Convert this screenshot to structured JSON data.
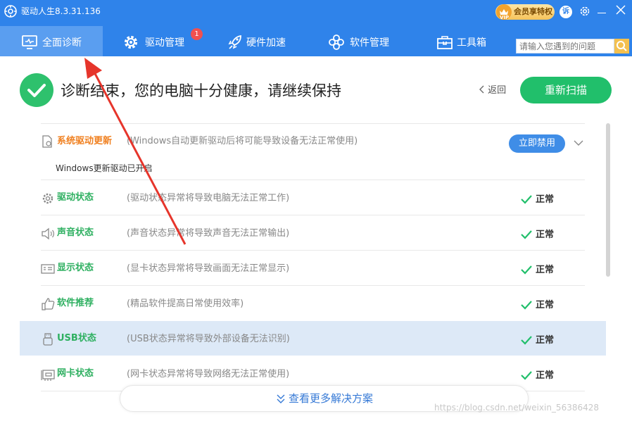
{
  "app": {
    "title": "驱动人生8.3.31.136"
  },
  "vip": {
    "label": "会员享特权",
    "mini": "VIP"
  },
  "window": {
    "sue_label": "诉"
  },
  "nav": {
    "tabs": [
      {
        "label": "全面诊断",
        "icon": "monitor-icon",
        "active": true
      },
      {
        "label": "驱动管理",
        "icon": "gear-icon"
      },
      {
        "label": "硬件加速",
        "icon": "rocket-icon"
      },
      {
        "label": "软件管理",
        "icon": "flower-icon"
      },
      {
        "label": "工具箱",
        "icon": "toolbox-icon"
      }
    ],
    "driver_badge": "1"
  },
  "search": {
    "placeholder": "请输入您遇到的问题"
  },
  "header": {
    "title": "诊断结束，您的电脑十分健康，请继续保持",
    "back": "返回",
    "rescan": "重新扫描"
  },
  "system_update": {
    "label": "系统驱动更新",
    "desc": "(Windows自动更新驱动后将可能导致设备无法正常使用)",
    "button": "立即禁用",
    "sub": "Windows更新驱动已开启"
  },
  "rows": [
    {
      "label": "驱动状态",
      "desc": "(驱动状态异常将导致电脑无法正常工作)",
      "status": "正常",
      "icon": "gear-icon"
    },
    {
      "label": "声音状态",
      "desc": "(声音状态异常将导致声音无法正常输出)",
      "status": "正常",
      "icon": "speaker-icon"
    },
    {
      "label": "显示状态",
      "desc": "(显卡状态异常将导致画面无法正常显示)",
      "status": "正常",
      "icon": "display-card-icon"
    },
    {
      "label": "软件推荐",
      "desc": "(精品软件提高日常使用效率)",
      "status": "正常",
      "icon": "thumbs-up-icon"
    },
    {
      "label": "USB状态",
      "desc": "(USB状态异常将导致外部设备无法识别)",
      "status": "正常",
      "icon": "usb-icon"
    },
    {
      "label": "网卡状态",
      "desc": "(网卡状态异常将导致网络无法正常使用)",
      "status": "正常",
      "icon": "network-card-icon"
    }
  ],
  "more": {
    "label": "查看更多解决方案"
  },
  "watermark": "https://blog.csdn.net/weixin_56386428",
  "colors": {
    "nav_bg": "#2f83ea",
    "success": "#21bf6b",
    "accent_orange": "#f08020",
    "annotation_arrow": "#e6352b"
  }
}
